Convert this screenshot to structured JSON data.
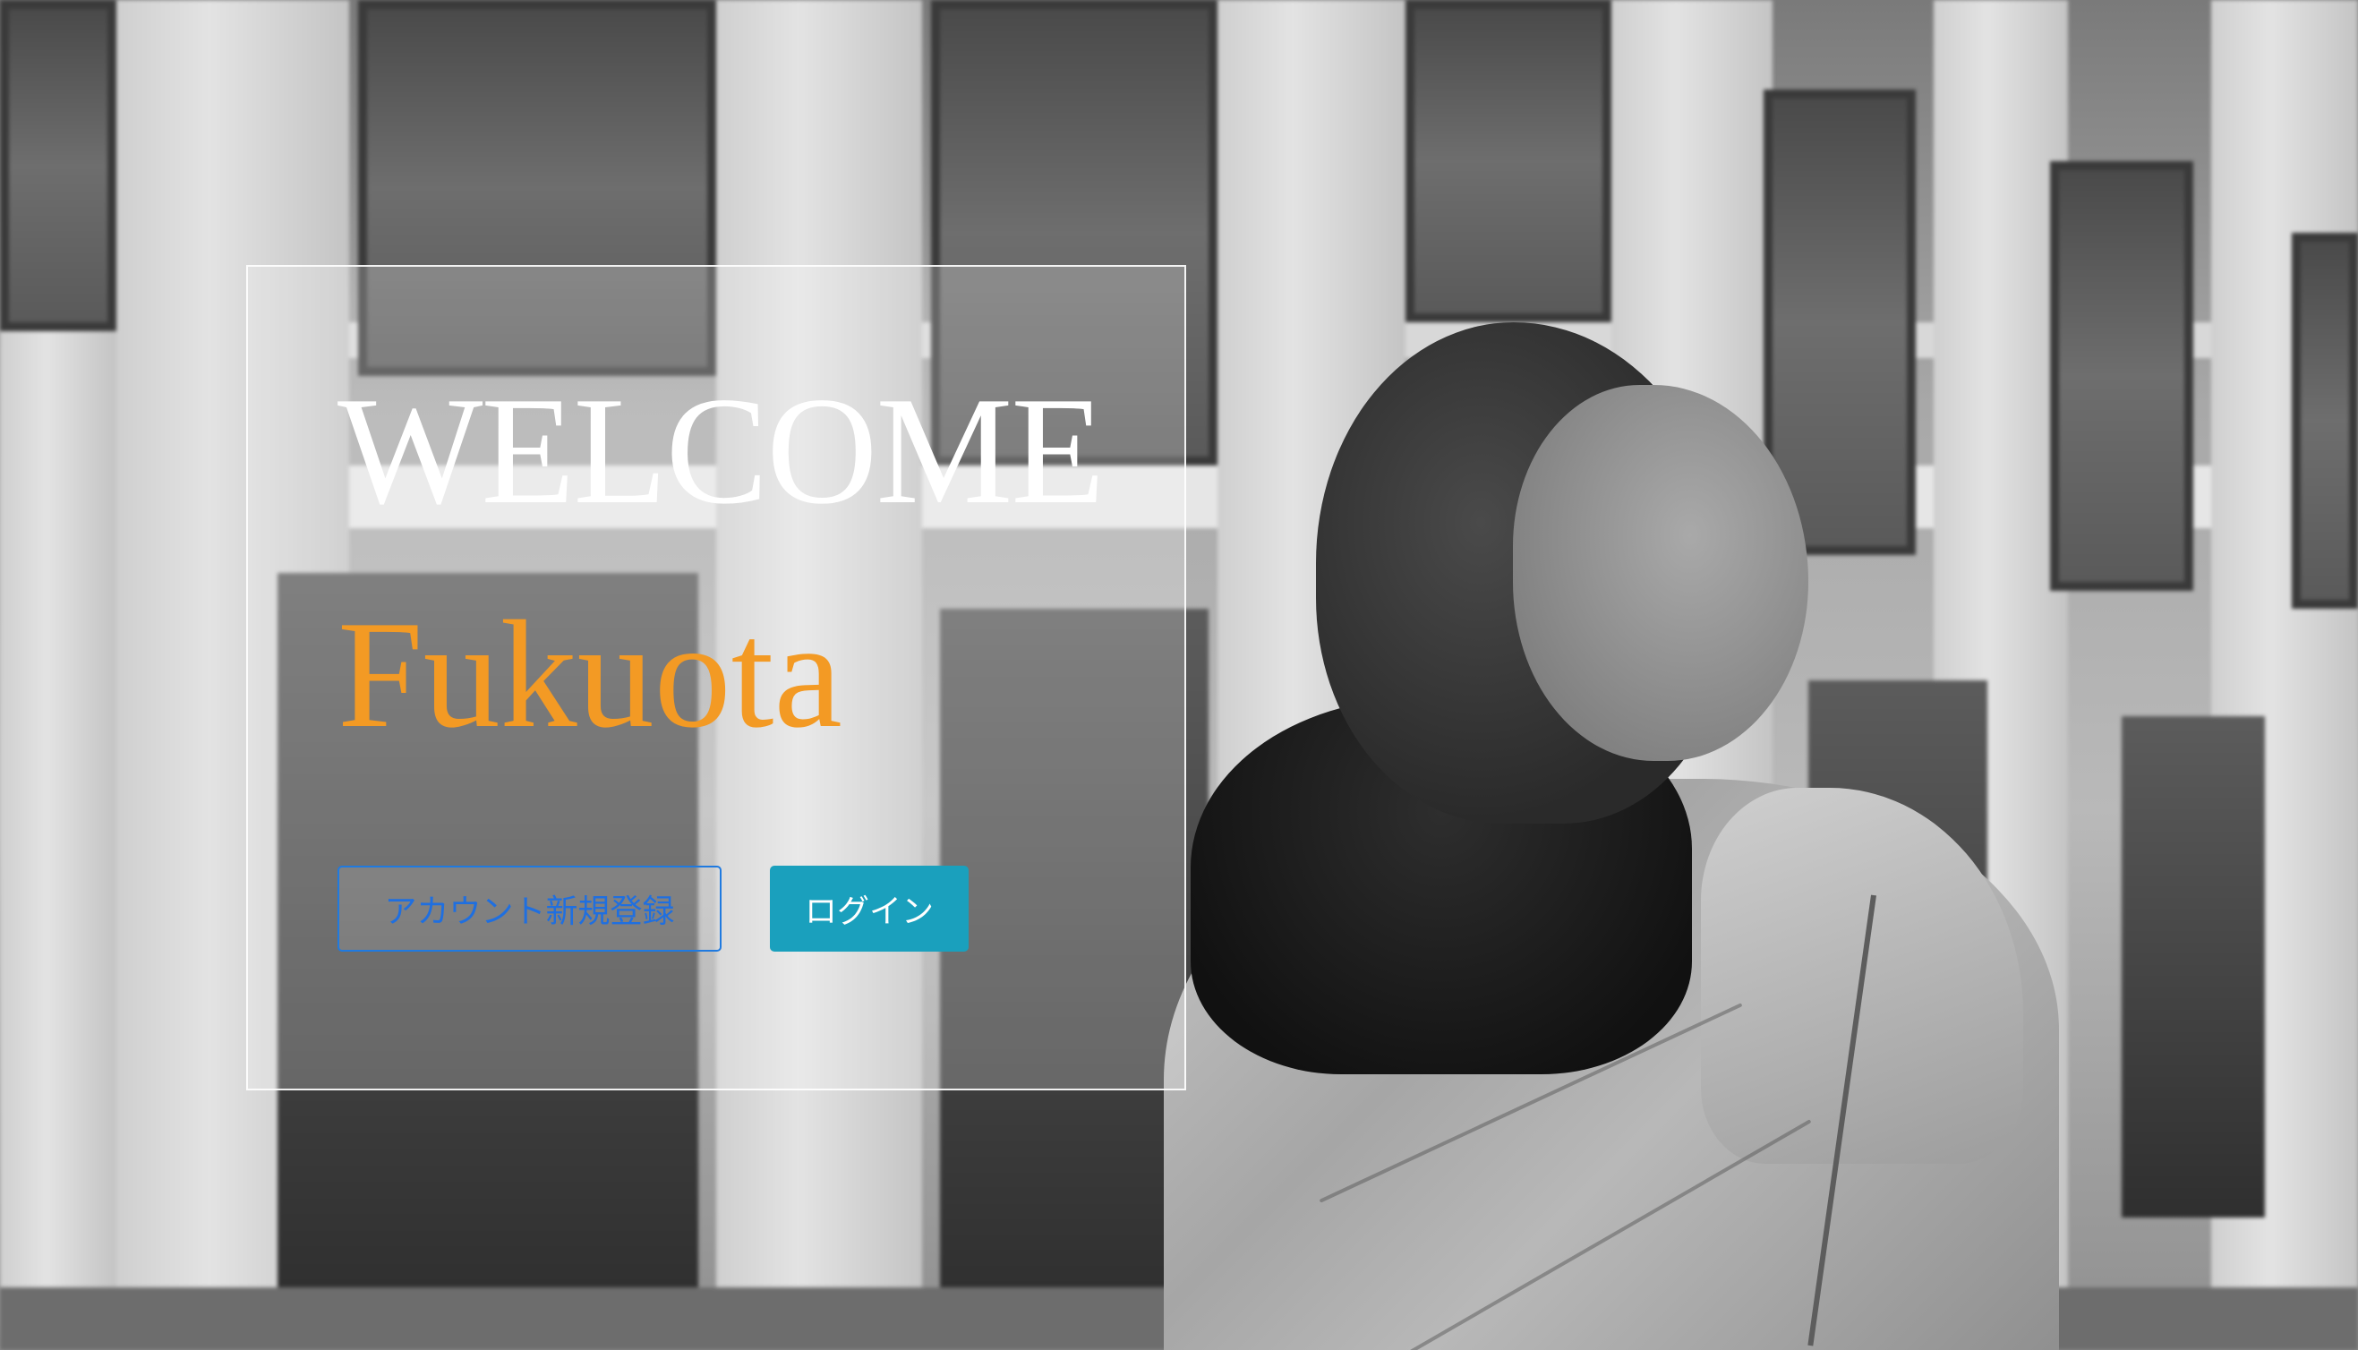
{
  "hero": {
    "title": "WELCOME",
    "city": "Fukuota",
    "city_color": "#f39a24",
    "background_photo": "grayscale-city-building-woman-looking-up"
  },
  "actions": {
    "signup_label": "アカウント新規登録",
    "login_label": "ログイン",
    "signup_color": "#1f7ae0",
    "login_bg_color": "#1aa0bd"
  }
}
